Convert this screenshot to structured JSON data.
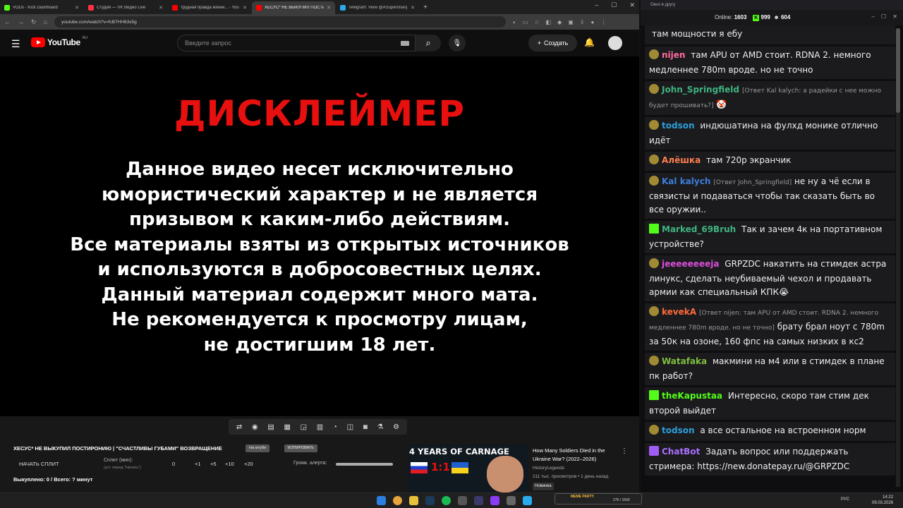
{
  "browser": {
    "tabs": [
      {
        "title": "VODs - Kick Dashboard",
        "color": "#53fc18"
      },
      {
        "title": "Студия — VK Видео Live",
        "color": "#ff3347"
      },
      {
        "title": "трудная правда жизни... - You",
        "color": "#ff0000"
      },
      {
        "title": "ХЕСУС* НЕ ВЫКУПИЛ ПОСТИ",
        "color": "#ff0000"
      },
      {
        "title": "Telegram: View @ASupersharij",
        "color": "#2aabee"
      }
    ],
    "new_tab": "+",
    "url": "youtube.com/watch?v=fcB7HH63s5g"
  },
  "youtube": {
    "logo_text": "YouTube",
    "region": "RU",
    "search_placeholder": "Введите запрос",
    "create_label": "Создать"
  },
  "video": {
    "title": "ДИСКЛЕЙМЕР",
    "lines": [
      "Данное видео несет исключительно",
      "юмористический характер и не является",
      "призывом к каким-либо действиям.",
      "Все материалы взяты из открытых источников",
      "и используются в добросовестных целях.",
      "Данный материал содержит много мата.",
      "Не рекомендуется к просмотру лицам,",
      "не достигшим 18 лет."
    ]
  },
  "panel": {
    "video_title": "ХЕСУС* НЕ ВЫКУПИЛ ПОСТИРОНИЮ | \"СЧАСТЛИВЫ ГУБАМИ\" ВОЗВРАЩЕНИЕ",
    "pill_1": "На ютубе",
    "pill_2": "КОПИРОВАТЬ",
    "start_split": "НАЧАТЬ СПЛИТ",
    "split_label": "Сплит (мин):",
    "split_sub": "(уст. перед \"Начать\")",
    "split_values": [
      "0",
      "+1",
      "+5",
      "+10",
      "+20"
    ],
    "alert_label": "Громк. алерта:",
    "stats": "Выкуплено: 0 / Всего: ? минут"
  },
  "recommendation": {
    "thumb_title": "4 YEARS OF CARNAGE",
    "thumb_score": "1:1",
    "title": "How Many Soldiers Died in the Ukraine War? (2022–2026)",
    "channel": "HistoryLegends",
    "views": "211 тыс. просмотров • 1 день назад",
    "badge": "Новинка"
  },
  "chat": {
    "window_title": "Окно в другу",
    "online_label": "Online:",
    "online_count": "1603",
    "kick_count": "999",
    "viewer_count": "604",
    "messages": [
      {
        "user": "",
        "color": "#ffffff",
        "reply": "",
        "text": "там мощности я ебу",
        "badge": "none"
      },
      {
        "user": "nijen",
        "color": "#ff6b9d",
        "reply": "",
        "text": "там APU от AMD стоит. RDNA 2. немного медленнее 780m вроде. но не точно",
        "badge": "gold"
      },
      {
        "user": "John_Springfield",
        "color": "#3fb37f",
        "reply": "[Ответ Kal kalych: а радейки с нее можно будет прошивать?]",
        "text": "🤡",
        "badge": "gold"
      },
      {
        "user": "todson",
        "color": "#2c9fd9",
        "reply": "",
        "text": "индюшатина на фулхд монике отлично идёт",
        "badge": "gold"
      },
      {
        "user": "Алёшка",
        "color": "#ff7f50",
        "reply": "",
        "text": "там 720р экранчик",
        "badge": "gold"
      },
      {
        "user": "Kal kalych",
        "color": "#3c7dd9",
        "reply": "[Ответ John_Springfield]",
        "text": "не ну а чё если в связисты и подаваться чтобы так сказать быть во все оружии..",
        "badge": "gold"
      },
      {
        "user": "Marked_69Bruh",
        "color": "#3fb37f",
        "reply": "",
        "text": "Так и зачем 4к на портативном устройстве?",
        "badge": "kick"
      },
      {
        "user": "jeeeeeeeeja",
        "color": "#d94fd9",
        "reply": "",
        "text": "GRPZDC накатить на стимдек астра линукс, сделать неубиваемый чехол и продавать армии как специальный КПК😭",
        "badge": "gold"
      },
      {
        "user": "kevekA",
        "color": "#ff6a3c",
        "reply": "[Ответ nijen: там APU от AMD стоит. RDNA 2. немного медленнее 780m вроде. но не точно]",
        "text": "брату брал ноут с 780m за 50к на озоне, 160 фпс на самых низких в кс2",
        "badge": "gold"
      },
      {
        "user": "Watafaka",
        "color": "#7fbf3f",
        "reply": "",
        "text": "макмини на м4 или в стимдек в плане пк работ?",
        "badge": "gold"
      },
      {
        "user": "theKapustaa",
        "color": "#53fc18",
        "reply": "",
        "text": "Интересно, скоро там стим дек второй выйдет",
        "badge": "kick"
      },
      {
        "user": "todson",
        "color": "#2c9fd9",
        "reply": "",
        "text": "а все остальное на встроенном норм",
        "badge": "gold"
      },
      {
        "user": "ChatBot",
        "color": "#a970ff",
        "reply": "",
        "text": "Задать вопрос или поддержать стримера: https://new.donatepay.ru/@GRPZDC",
        "badge": "bot"
      }
    ]
  },
  "taskbar": {
    "meme_label": "MEME PARTY",
    "meme_progress": "275 / 1500",
    "lang": "РУС",
    "time": "14:22",
    "date": "09.03.2026"
  }
}
